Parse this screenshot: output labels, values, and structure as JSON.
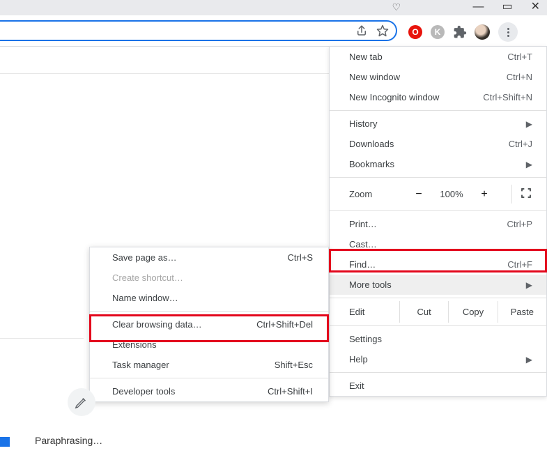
{
  "sys": {
    "min": "—",
    "max": "▭",
    "close": "✕",
    "heart": "♡"
  },
  "toolbar": {
    "red_ext": "O",
    "gray_ext": "K"
  },
  "main_menu": {
    "new_tab": "New tab",
    "new_tab_sc": "Ctrl+T",
    "new_window": "New window",
    "new_window_sc": "Ctrl+N",
    "incognito": "New Incognito window",
    "incognito_sc": "Ctrl+Shift+N",
    "history": "History",
    "downloads": "Downloads",
    "downloads_sc": "Ctrl+J",
    "bookmarks": "Bookmarks",
    "zoom_label": "Zoom",
    "zoom_minus": "−",
    "zoom_pct": "100%",
    "zoom_plus": "+",
    "print": "Print…",
    "print_sc": "Ctrl+P",
    "cast": "Cast…",
    "find": "Find…",
    "find_sc": "Ctrl+F",
    "more_tools": "More tools",
    "edit": "Edit",
    "cut": "Cut",
    "copy": "Copy",
    "paste": "Paste",
    "settings": "Settings",
    "help": "Help",
    "exit": "Exit"
  },
  "sub_menu": {
    "save_page": "Save page as…",
    "save_page_sc": "Ctrl+S",
    "create_shortcut": "Create shortcut…",
    "name_window": "Name window…",
    "clear_data": "Clear browsing data…",
    "clear_data_sc": "Ctrl+Shift+Del",
    "extensions": "Extensions",
    "task_manager": "Task manager",
    "task_manager_sc": "Shift+Esc",
    "dev_tools": "Developer tools",
    "dev_tools_sc": "Ctrl+Shift+I"
  },
  "page": {
    "paraphrasing": "Paraphrasing…"
  }
}
